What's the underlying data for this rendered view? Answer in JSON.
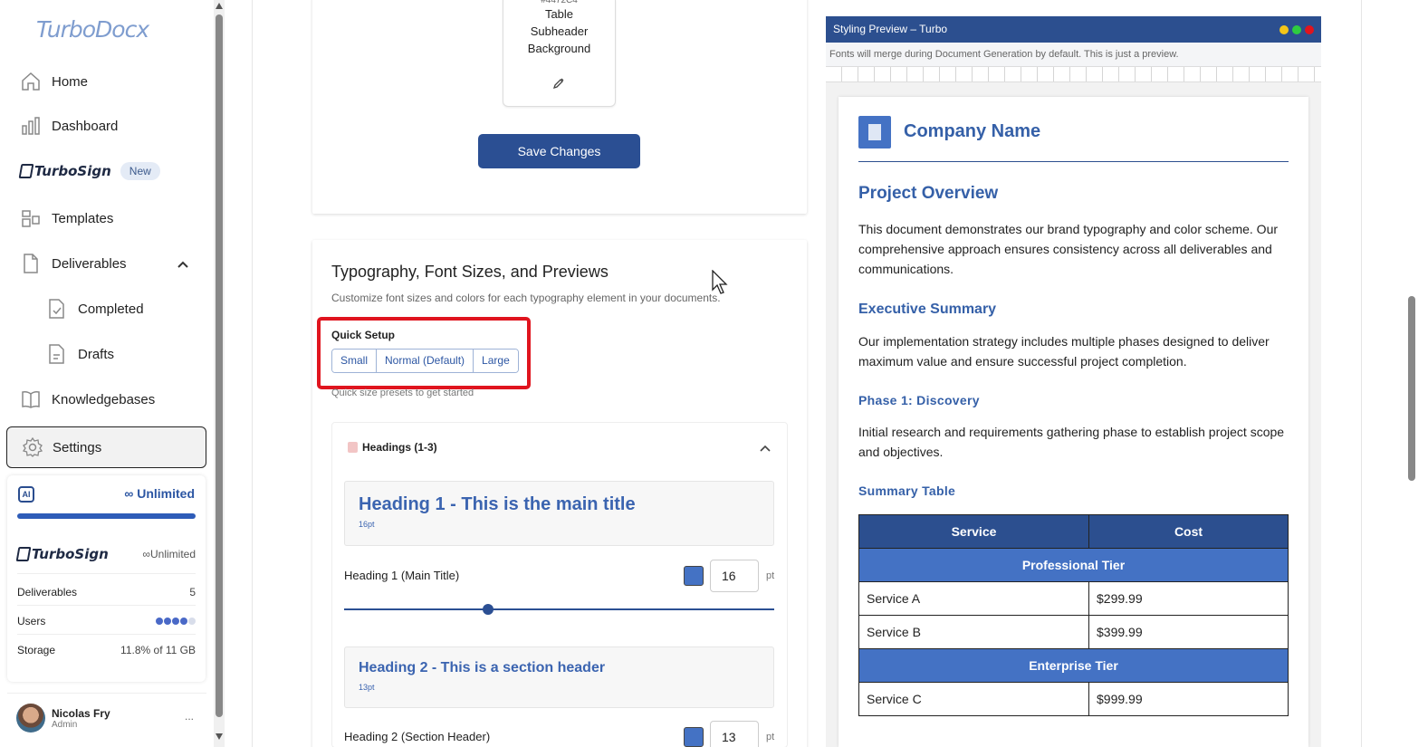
{
  "sidebar": {
    "logo": "TurboDocx",
    "nav": {
      "home": "Home",
      "dashboard": "Dashboard",
      "turbosign": "TurboSign",
      "turbosign_badge": "New",
      "templates": "Templates",
      "deliverables": "Deliverables",
      "completed": "Completed",
      "drafts": "Drafts",
      "knowledgebases": "Knowledgebases",
      "settings": "Settings"
    },
    "usage": {
      "ai_label": "AI",
      "ai_plan": "Unlimited",
      "ai_usage_fraction": 1.0,
      "turbosign_label": "TurboSign",
      "turbosign_plan": "Unlimited",
      "rows": [
        {
          "label": "Deliverables",
          "value": "5"
        },
        {
          "label": "Users",
          "value": "",
          "dots_filled": 4,
          "dots_total": 5
        },
        {
          "label": "Storage",
          "value": "11.8% of 11 GB"
        }
      ]
    },
    "user": {
      "name": "Nicolas Fry",
      "role": "Admin",
      "menu": "..."
    }
  },
  "color_tile": {
    "hex": "#4472C4",
    "label_lines": [
      "Table",
      "Subheader",
      "Background"
    ]
  },
  "save_button": "Save Changes",
  "typography": {
    "title": "Typography, Font Sizes, and Previews",
    "subtitle": "Customize font sizes and colors for each typography element in your documents.",
    "quick_setup": {
      "label": "Quick Setup",
      "options": [
        "Small",
        "Normal (Default)",
        "Large"
      ],
      "hint": "Quick size presets to get started"
    },
    "accordion_title": "Headings (1-3)",
    "headings": [
      {
        "preview": "Heading 1 - This is the main title",
        "size_label": "16pt",
        "label": "Heading 1 (Main Title)",
        "value": "16",
        "unit": "pt",
        "color": "#4472c4",
        "slider_fraction": 0.33
      },
      {
        "preview": "Heading 2 - This is a section header",
        "size_label": "13pt",
        "label": "Heading 2 (Section Header)",
        "value": "13",
        "unit": "pt",
        "color": "#4472c4"
      }
    ]
  },
  "preview": {
    "window_title": "Styling Preview – Turbo",
    "note": "Fonts will merge during Document Generation by default. This is just a preview.",
    "dot_colors": [
      "#f5c518",
      "#2ecc40",
      "#e0141e"
    ],
    "company": "Company Name",
    "h1": "Project Overview",
    "p1": "This document demonstrates our brand typography and color scheme. Our comprehensive approach ensures consistency across all deliverables and communications.",
    "h2": "Executive Summary",
    "p2": "Our implementation strategy includes multiple phases designed to deliver maximum value and ensure successful project completion.",
    "h3": "Phase 1: Discovery",
    "p3": "Initial research and requirements gathering phase to establish project scope and objectives.",
    "table_title": "Summary Table",
    "table": {
      "headers": [
        "Service",
        "Cost"
      ],
      "rows": [
        {
          "sub": "Professional Tier"
        },
        {
          "cells": [
            "Service A",
            "$299.99"
          ]
        },
        {
          "cells": [
            "Service B",
            "$399.99"
          ]
        },
        {
          "sub": "Enterprise Tier"
        },
        {
          "cells": [
            "Service C",
            "$999.99"
          ]
        }
      ]
    }
  }
}
